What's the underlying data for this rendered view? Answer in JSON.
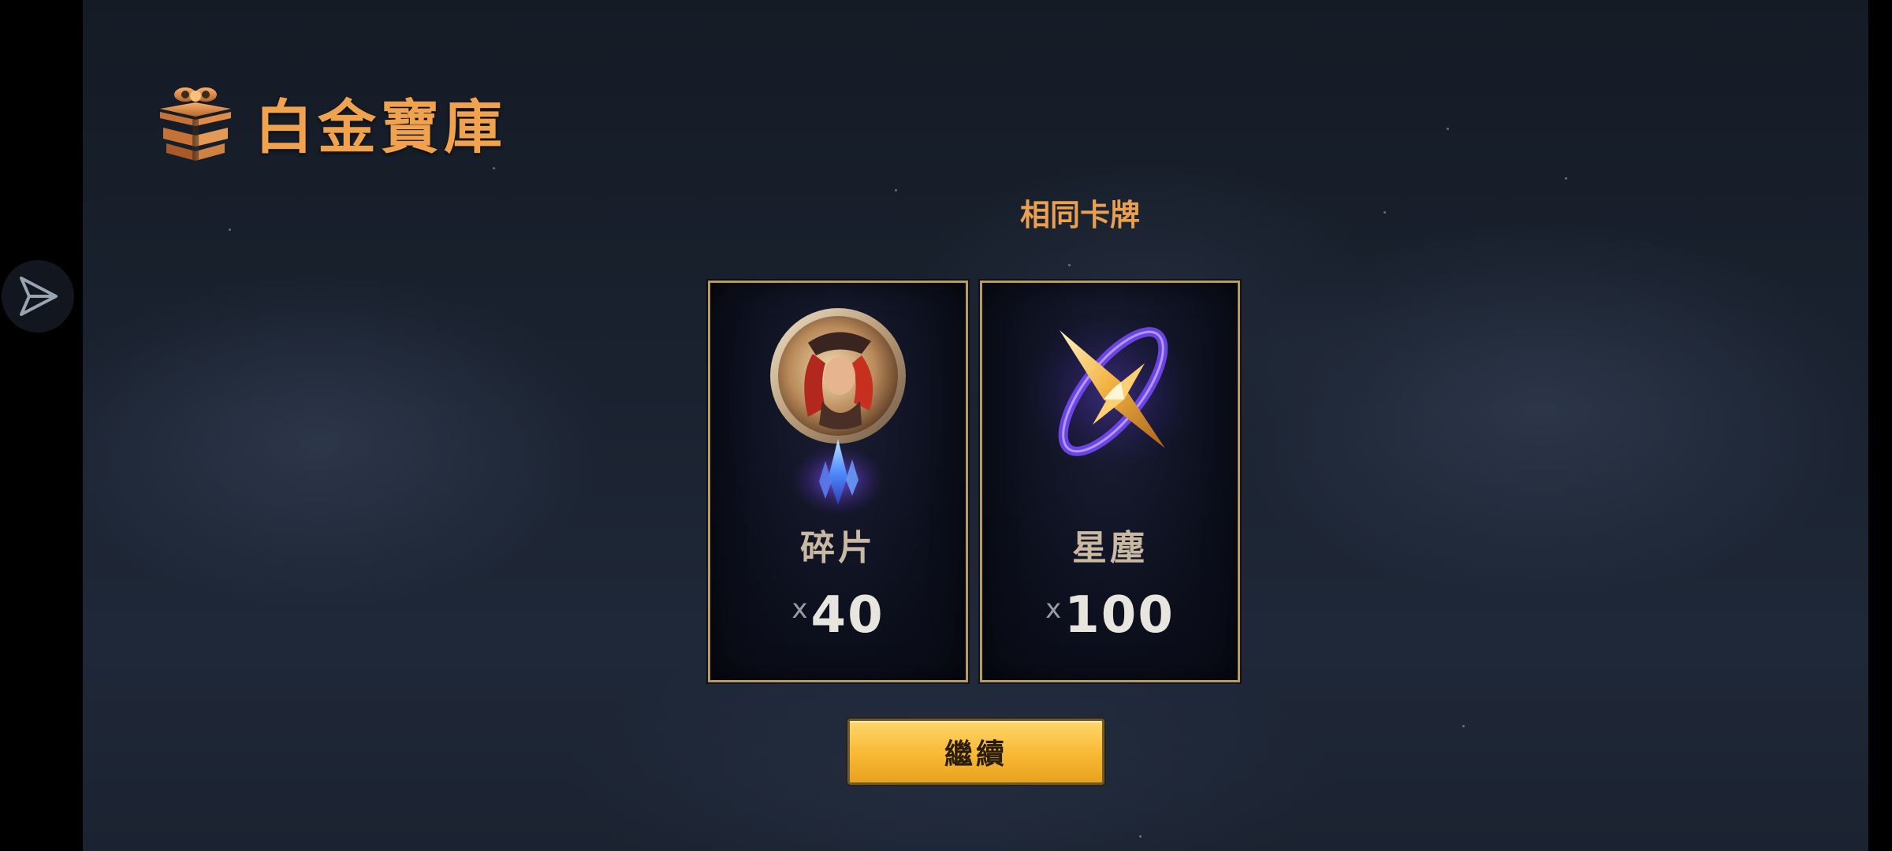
{
  "vault": {
    "title": "白金寶庫",
    "logo_icon": "gift-box-icon"
  },
  "side": {
    "send_icon": "paper-plane-icon"
  },
  "section": {
    "label": "相同卡牌"
  },
  "rewards": [
    {
      "name": "碎片",
      "qty_prefix": "x",
      "qty": "40",
      "icon": "champion-shard-icon"
    },
    {
      "name": "星塵",
      "qty_prefix": "x",
      "qty": "100",
      "icon": "stardust-icon"
    }
  ],
  "continue": {
    "label": "繼續"
  },
  "colors": {
    "title_orange": "#f0a24e",
    "card_border": "#b89a5a",
    "button_gold": "#f7b834"
  }
}
